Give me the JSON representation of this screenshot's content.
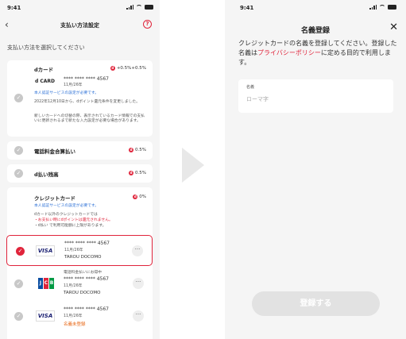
{
  "status_time": "9:41",
  "left": {
    "nav_title": "支払い方法設定",
    "back_icon": "chevron-left-icon",
    "help_icon": "question-circle-icon",
    "help_glyph": "?",
    "subtitle": "支払い方法を選択してください",
    "dcard": {
      "title": "dカード",
      "badge": "+0.5%+0.5%",
      "logo": "d CARD",
      "number": "**** **** **** 4567",
      "expiry": "11月/26年",
      "auth_note": "本人認証サービスの設定が必要です。",
      "note1": "2022年12月10日から、dポイント還元条件を変更しました。",
      "note2": "新しいカードへの切替の際、表示されているカード情報での支払いに更新されるまで新たな入力設定が必要な場合があります。"
    },
    "carrier": {
      "title": "電話料金合算払い",
      "badge": "0.5%"
    },
    "balance": {
      "title": "d払い残高",
      "badge": "0.5%"
    },
    "credit": {
      "title": "クレジットカード",
      "badge": "0%",
      "auth_note": "本人認証サービスの設定が必要です。",
      "note1": "dカード以外のクレジットカードでは",
      "note2": "・お支払い時にdポイントは還元されません。",
      "note3": "・d払い で利用可能額に上限があります。"
    },
    "cards": [
      {
        "brand": "VISA",
        "number": "**** **** **** 4567",
        "expiry": "11月/26年",
        "holder": "TAROU DOCOMO",
        "pre": ""
      },
      {
        "brand": "JCB",
        "number": "**** **** **** 4567",
        "expiry": "11月/26年",
        "holder": "TAROU DOCOMO",
        "pre": "電話料金払いにお得中"
      },
      {
        "brand": "VISA",
        "number": "**** **** **** 4567",
        "expiry": "11月/26年",
        "holder": "名義未登録",
        "pre": ""
      }
    ],
    "more_glyph": "···",
    "check_glyph": "✓"
  },
  "right": {
    "title": "名義登録",
    "close_glyph": "✕",
    "desc_part1": "クレジットカードの名義を登録してください。登録した名義は",
    "desc_link": "プライバシーポリシー",
    "desc_part2": "に定める目的で利用します。",
    "field_label": "名義",
    "field_placeholder": "ローマ字",
    "submit_label": "登録する"
  },
  "colors": {
    "accent": "#e0243b",
    "link_blue": "#2a6fd6",
    "background": "#f5f5f5"
  }
}
